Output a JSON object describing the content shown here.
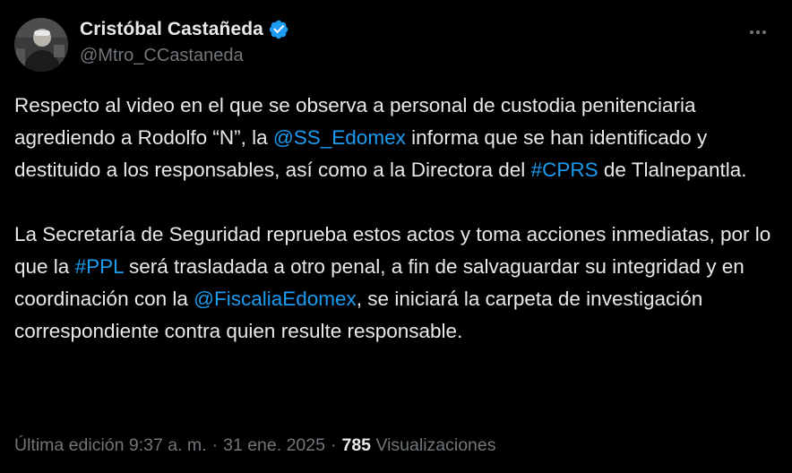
{
  "author": {
    "display_name": "Cristóbal Castañeda",
    "handle": "@Mtro_CCastaneda",
    "verified_icon": "verified-badge-icon",
    "verified_color": "#1d9bf0"
  },
  "post": {
    "p1": {
      "t1": "Respecto al video en el que se observa a personal de custodia penitenciaria agrediendo a Rodolfo “N”, la ",
      "m1": "@SS_Edomex",
      "t2": " informa que se han identificado y destituido a los responsables, así como a la Directora del ",
      "h1": "#CPRS",
      "t3": " de Tlalnepantla."
    },
    "p2": {
      "t1": "La Secretaría de Seguridad reprueba estos actos y toma acciones inmediatas, por lo que la ",
      "h1": "#PPL",
      "t2": " será trasladada a otro penal, a fin de salvaguardar su integridad y en coordinación con la ",
      "m1": "@FiscaliaEdomex",
      "t3": ", se iniciará la carpeta de investigación correspondiente contra quien resulte responsable."
    }
  },
  "meta": {
    "edited": "Última edición 9:37 a. m.",
    "dot": "·",
    "date": "31 ene. 2025",
    "views_count": "785",
    "views_label": "Visualizaciones"
  },
  "colors": {
    "background": "#000000",
    "text": "#e7e9ea",
    "secondary": "#71767b",
    "link": "#1d9bf0"
  }
}
